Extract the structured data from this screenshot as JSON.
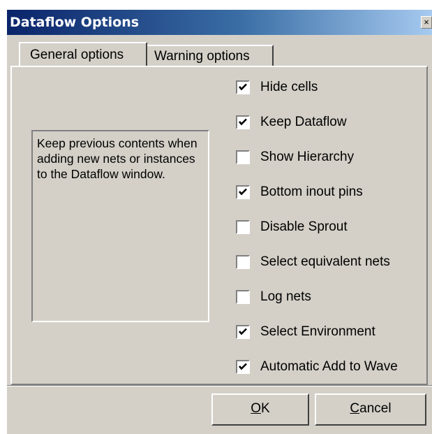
{
  "window": {
    "title": "Dataflow Options",
    "close_glyph": "×"
  },
  "tabs": [
    {
      "label": "General options",
      "active": true
    },
    {
      "label": "Warning options",
      "active": false
    }
  ],
  "description": "Keep previous contents when adding new nets or instances to the Dataflow window.",
  "options": [
    {
      "label": "Hide cells",
      "checked": true
    },
    {
      "label": "Keep Dataflow",
      "checked": true
    },
    {
      "label": "Show Hierarchy",
      "checked": false
    },
    {
      "label": "Bottom inout pins",
      "checked": true
    },
    {
      "label": "Disable Sprout",
      "checked": false
    },
    {
      "label": "Select equivalent nets",
      "checked": false
    },
    {
      "label": "Log nets",
      "checked": false
    },
    {
      "label": "Select Environment",
      "checked": true
    },
    {
      "label": "Automatic Add to Wave",
      "checked": true
    }
  ],
  "buttons": {
    "ok": {
      "mnemonic": "O",
      "rest": "K"
    },
    "cancel": {
      "mnemonic": "C",
      "rest": "ancel"
    }
  },
  "colors": {
    "face": "#d4d0c8",
    "title_start": "#0a246a",
    "title_end": "#a6caf0"
  },
  "icons": {
    "close": "close-icon",
    "check": "checkmark-icon"
  }
}
